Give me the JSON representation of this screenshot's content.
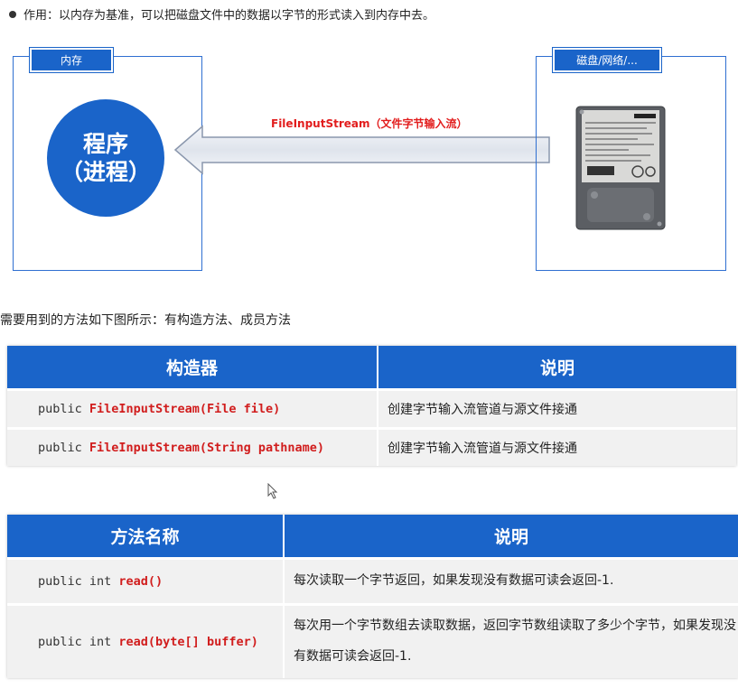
{
  "bullet": {
    "text": "作用：以内存为基准，可以把磁盘文件中的数据以字节的形式读入到内存中去。"
  },
  "diagram": {
    "memory_tag": "内存",
    "source_tag": "磁盘/网络/...",
    "program_line1": "程序",
    "program_line2": "（进程）",
    "arrow_label": "FileInputStream（文件字节输入流）",
    "accent_color": "#1a64c9",
    "label_color": "#e21d1d"
  },
  "intro": "需要用到的方法如下图所示：有构造方法、成员方法",
  "constructors": {
    "headers": [
      "构造器",
      "说明"
    ],
    "rows": [
      {
        "prefix": "public ",
        "name": "FileInputStream(File file)",
        "desc": "创建字节输入流管道与源文件接通"
      },
      {
        "prefix": "public ",
        "name": "FileInputStream(String pathname)",
        "desc": "创建字节输入流管道与源文件接通"
      }
    ]
  },
  "methods": {
    "headers": [
      "方法名称",
      "说明"
    ],
    "rows": [
      {
        "prefix": "public int ",
        "name": "read()",
        "desc": "每次读取一个字节返回，如果发现没有数据可读会返回-1."
      },
      {
        "prefix": "public int ",
        "name": "read(byte[] buffer)",
        "desc": "每次用一个字节数组去读取数据，返回字节数组读取了多少个字节，如果发现没有数据可读会返回-1."
      }
    ]
  }
}
